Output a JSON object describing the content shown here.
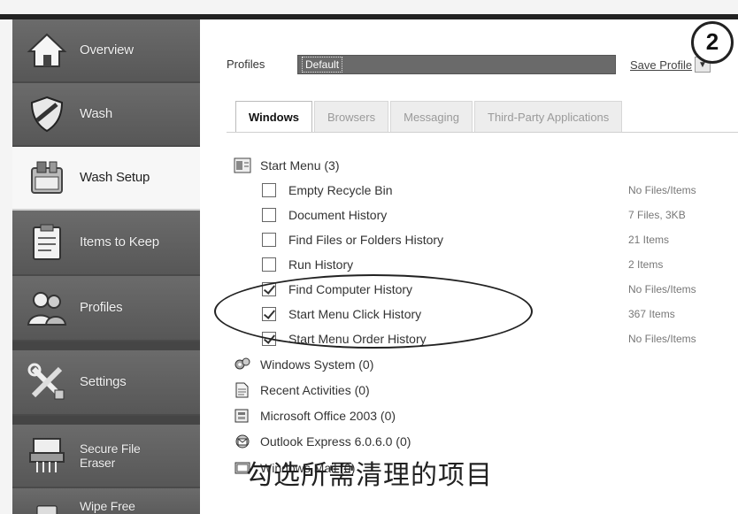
{
  "sidebar": {
    "items": [
      {
        "label": "Overview",
        "icon": "home-icon"
      },
      {
        "label": "Wash",
        "icon": "shield-icon"
      },
      {
        "label": "Wash Setup",
        "icon": "wash-setup-icon"
      },
      {
        "label": "Items to Keep",
        "icon": "clipboard-icon"
      },
      {
        "label": "Profiles",
        "icon": "users-icon"
      },
      {
        "label": "Settings",
        "icon": "tools-icon"
      },
      {
        "label": "Secure File Eraser",
        "icon": "shredder-icon"
      },
      {
        "label": "Wipe Free",
        "icon": "disk-icon"
      }
    ],
    "active": "Wash Setup"
  },
  "profile": {
    "label": "Profiles",
    "value": "Default",
    "save_label": "Save Profile"
  },
  "step_number": "2",
  "tabs": [
    {
      "label": "Windows",
      "active": true
    },
    {
      "label": "Browsers",
      "active": false
    },
    {
      "label": "Messaging",
      "active": false
    },
    {
      "label": "Third-Party Applications",
      "active": false
    }
  ],
  "tree": {
    "start_menu": {
      "label": "Start Menu (3)",
      "items": [
        {
          "label": "Empty Recycle Bin",
          "checked": false,
          "info": "No Files/Items"
        },
        {
          "label": "Document History",
          "checked": false,
          "info": "7 Files, 3KB"
        },
        {
          "label": "Find Files or Folders History",
          "checked": false,
          "info": "21 Items"
        },
        {
          "label": "Run History",
          "checked": false,
          "info": "2 Items"
        },
        {
          "label": "Find Computer History",
          "checked": true,
          "info": "No Files/Items"
        },
        {
          "label": "Start Menu Click History",
          "checked": true,
          "info": "367 Items"
        },
        {
          "label": "Start Menu Order History",
          "checked": true,
          "info": "No Files/Items"
        }
      ]
    },
    "groups": [
      {
        "label": "Windows System (0)",
        "icon": "gear-icon"
      },
      {
        "label": "Recent Activities (0)",
        "icon": "document-icon"
      },
      {
        "label": "Microsoft Office 2003 (0)",
        "icon": "office-icon"
      },
      {
        "label": "Outlook Express 6.0.6.0 (0)",
        "icon": "outlook-icon"
      },
      {
        "label": "Windows Mail (0)",
        "icon": "mail-icon"
      }
    ]
  },
  "caption": "勾选所需清理的项目",
  "colors": {
    "sidebar_bg": "#5e5e5e",
    "active_item_bg": "#f7f7f7",
    "select_bg": "#6a6a6a"
  }
}
